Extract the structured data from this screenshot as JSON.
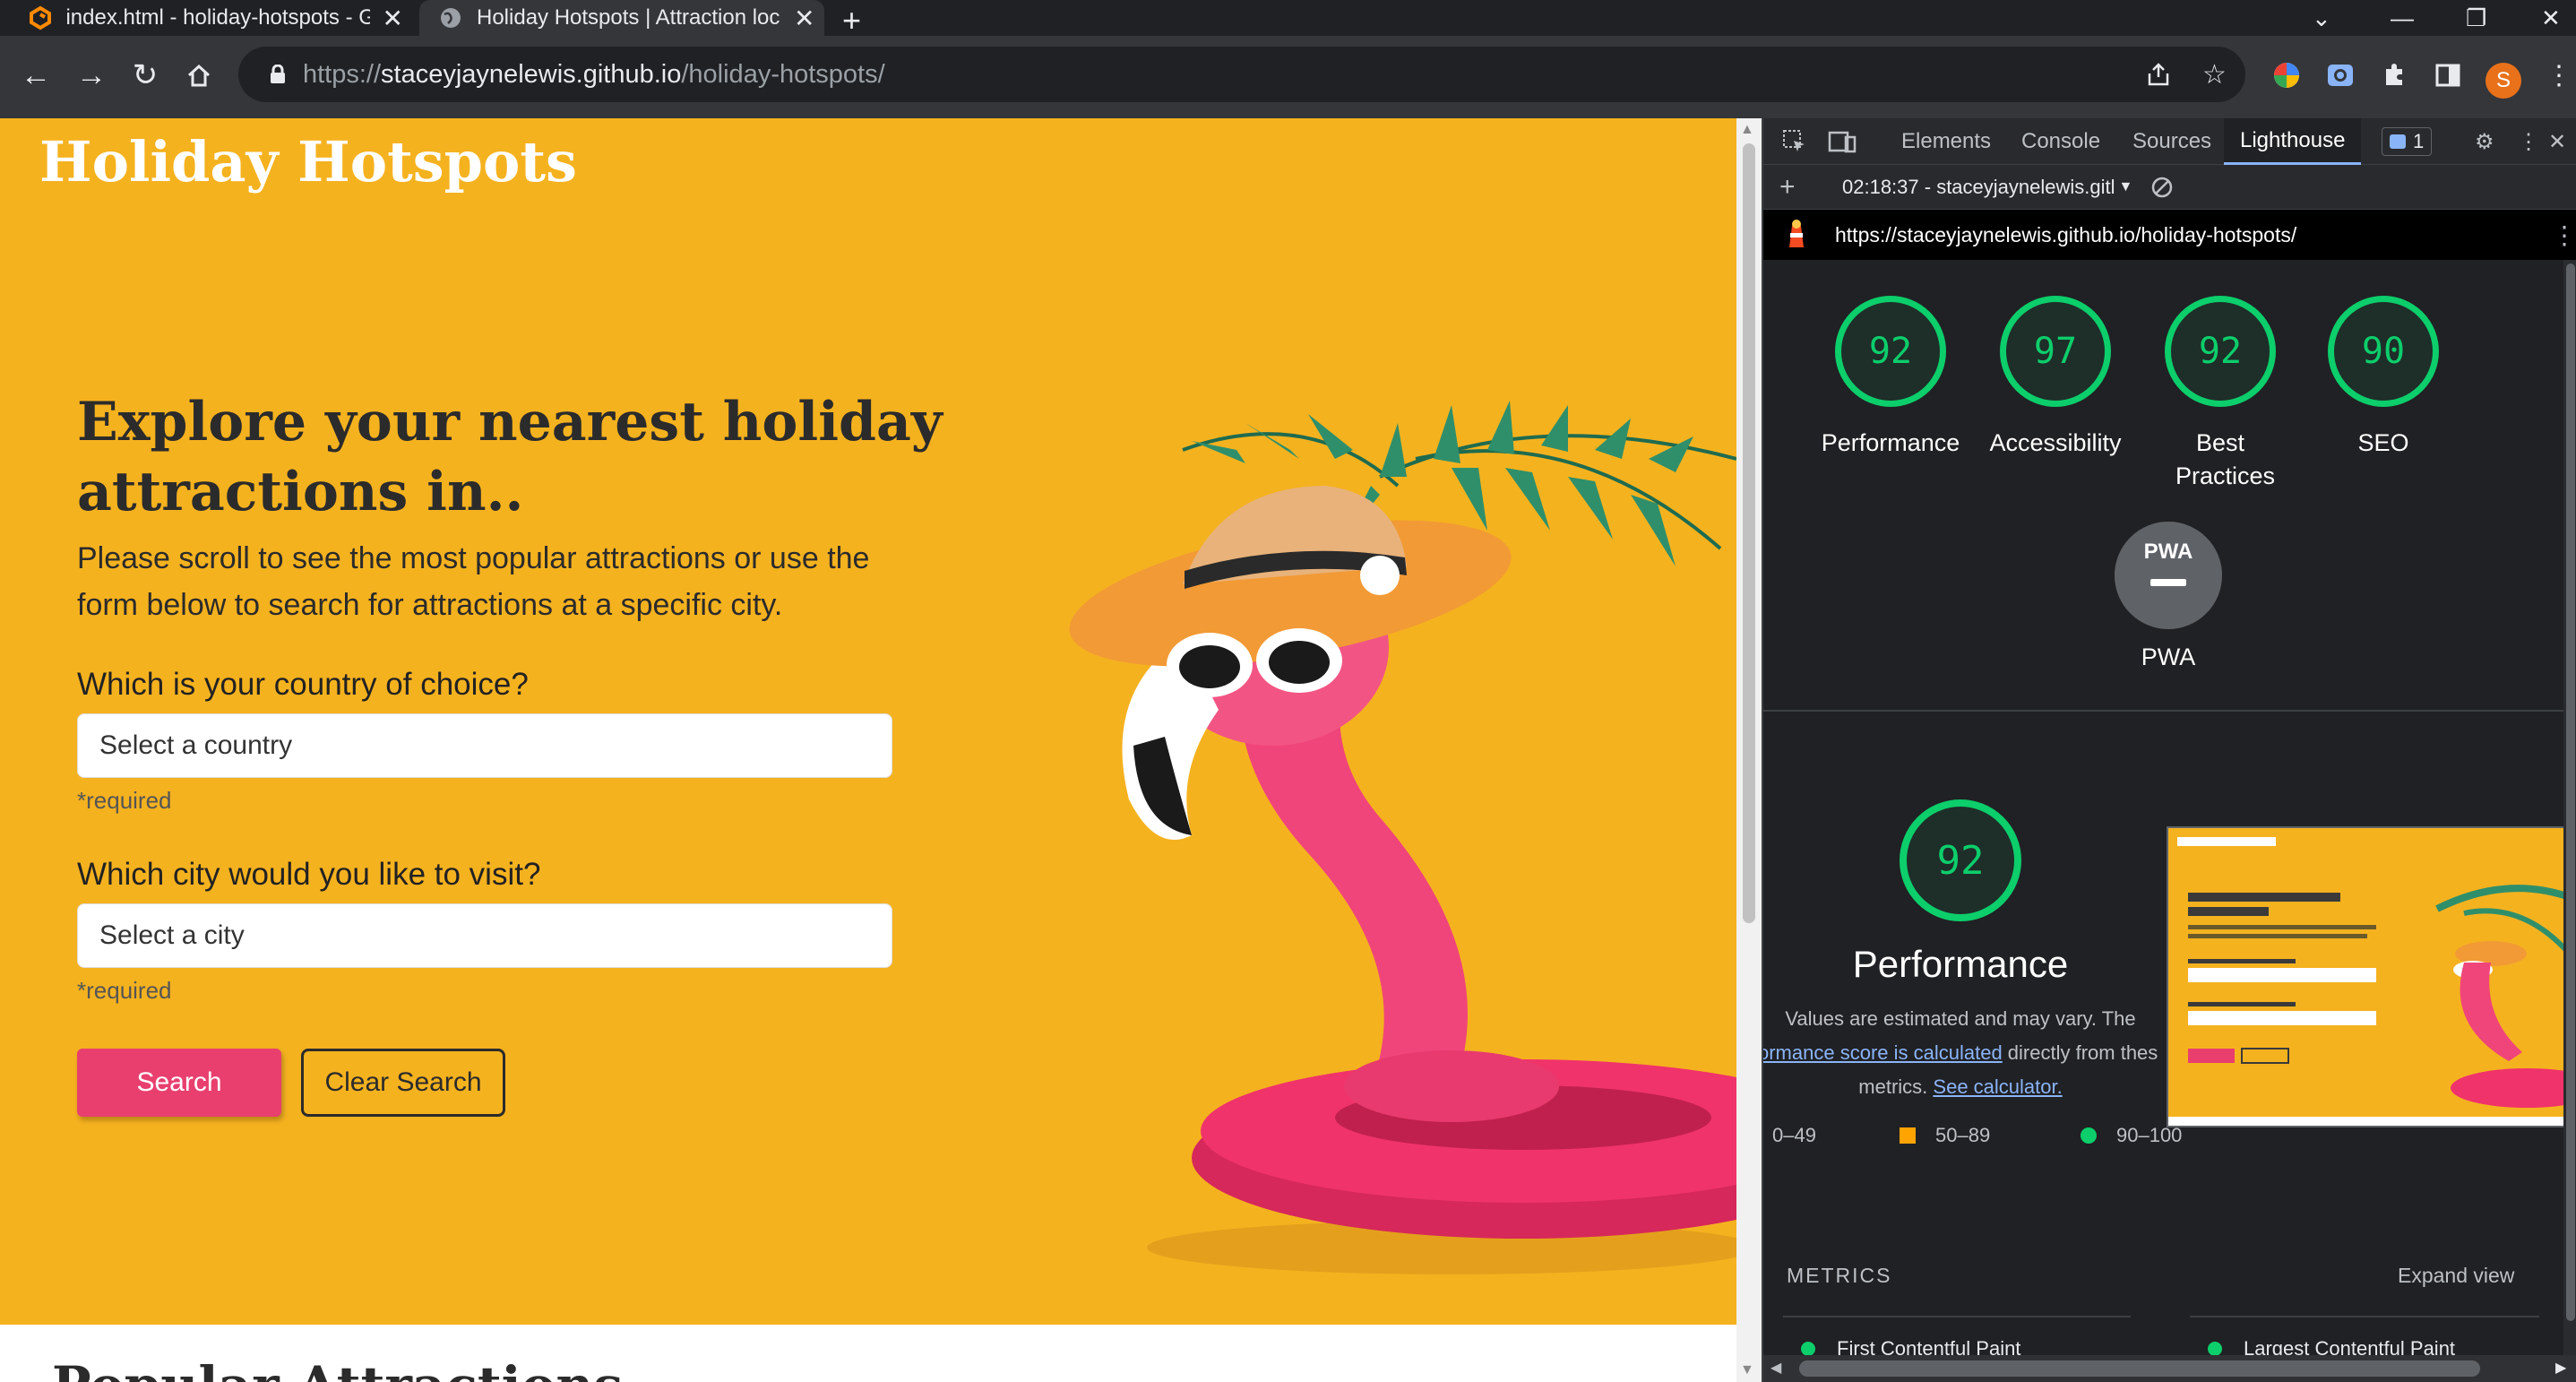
{
  "tabs": [
    {
      "title": "index.html - holiday-hotspots - G"
    },
    {
      "title": "Holiday Hotspots | Attraction loc"
    }
  ],
  "toolbar": {
    "url_scheme": "https://",
    "url_host": "staceyjaynelewis.github.io",
    "url_path": "/holiday-hotspots/",
    "avatar_letter": "S"
  },
  "site": {
    "brand": "Holiday Hotspots",
    "heading": "Explore your nearest holiday attractions in..",
    "intro": "Please scroll to see the most popular attractions or use the form below to search for attractions at a specific city.",
    "country_label": "Which is your country of choice?",
    "country_placeholder": "Select a country",
    "city_label": "Which city would you like to visit?",
    "city_placeholder": "Select a city",
    "required": "*required",
    "search_button": "Search",
    "clear_button": "Clear Search",
    "popular_heading": "Popular Attractions"
  },
  "devtools": {
    "tabs": [
      "Elements",
      "Console",
      "Sources",
      "Lighthouse"
    ],
    "issues_count": "1",
    "report_time": "02:18:37 - staceyjaynelewis.gitl",
    "report_url": "https://staceyjaynelewis.github.io/holiday-hotspots/",
    "scores": [
      {
        "value": "92",
        "label": "Performance"
      },
      {
        "value": "97",
        "label": "Accessibility"
      },
      {
        "value": "92",
        "label": "Best Practices"
      },
      {
        "value": "90",
        "label": "SEO"
      }
    ],
    "pwa_label": "PWA",
    "pwa_badge": "PWA",
    "performance_score": "92",
    "performance_title": "Performance",
    "desc_line1": "Values are estimated and may vary. The",
    "desc_link1": "ormance score is calculated",
    "desc_line2_rest": " directly from these",
    "desc_line3": "metrics. ",
    "desc_link2": "See calculator.",
    "legend": [
      {
        "range": "0–49",
        "color": "#ff4e42"
      },
      {
        "range": "50–89",
        "color": "#ffa400"
      },
      {
        "range": "90–100",
        "color": "#0cce6b"
      }
    ],
    "metrics_heading": "METRICS",
    "expand_view": "Expand view",
    "metric_fcp": "First Contentful Paint",
    "metric_lcp": "Largest Contentful Paint"
  }
}
